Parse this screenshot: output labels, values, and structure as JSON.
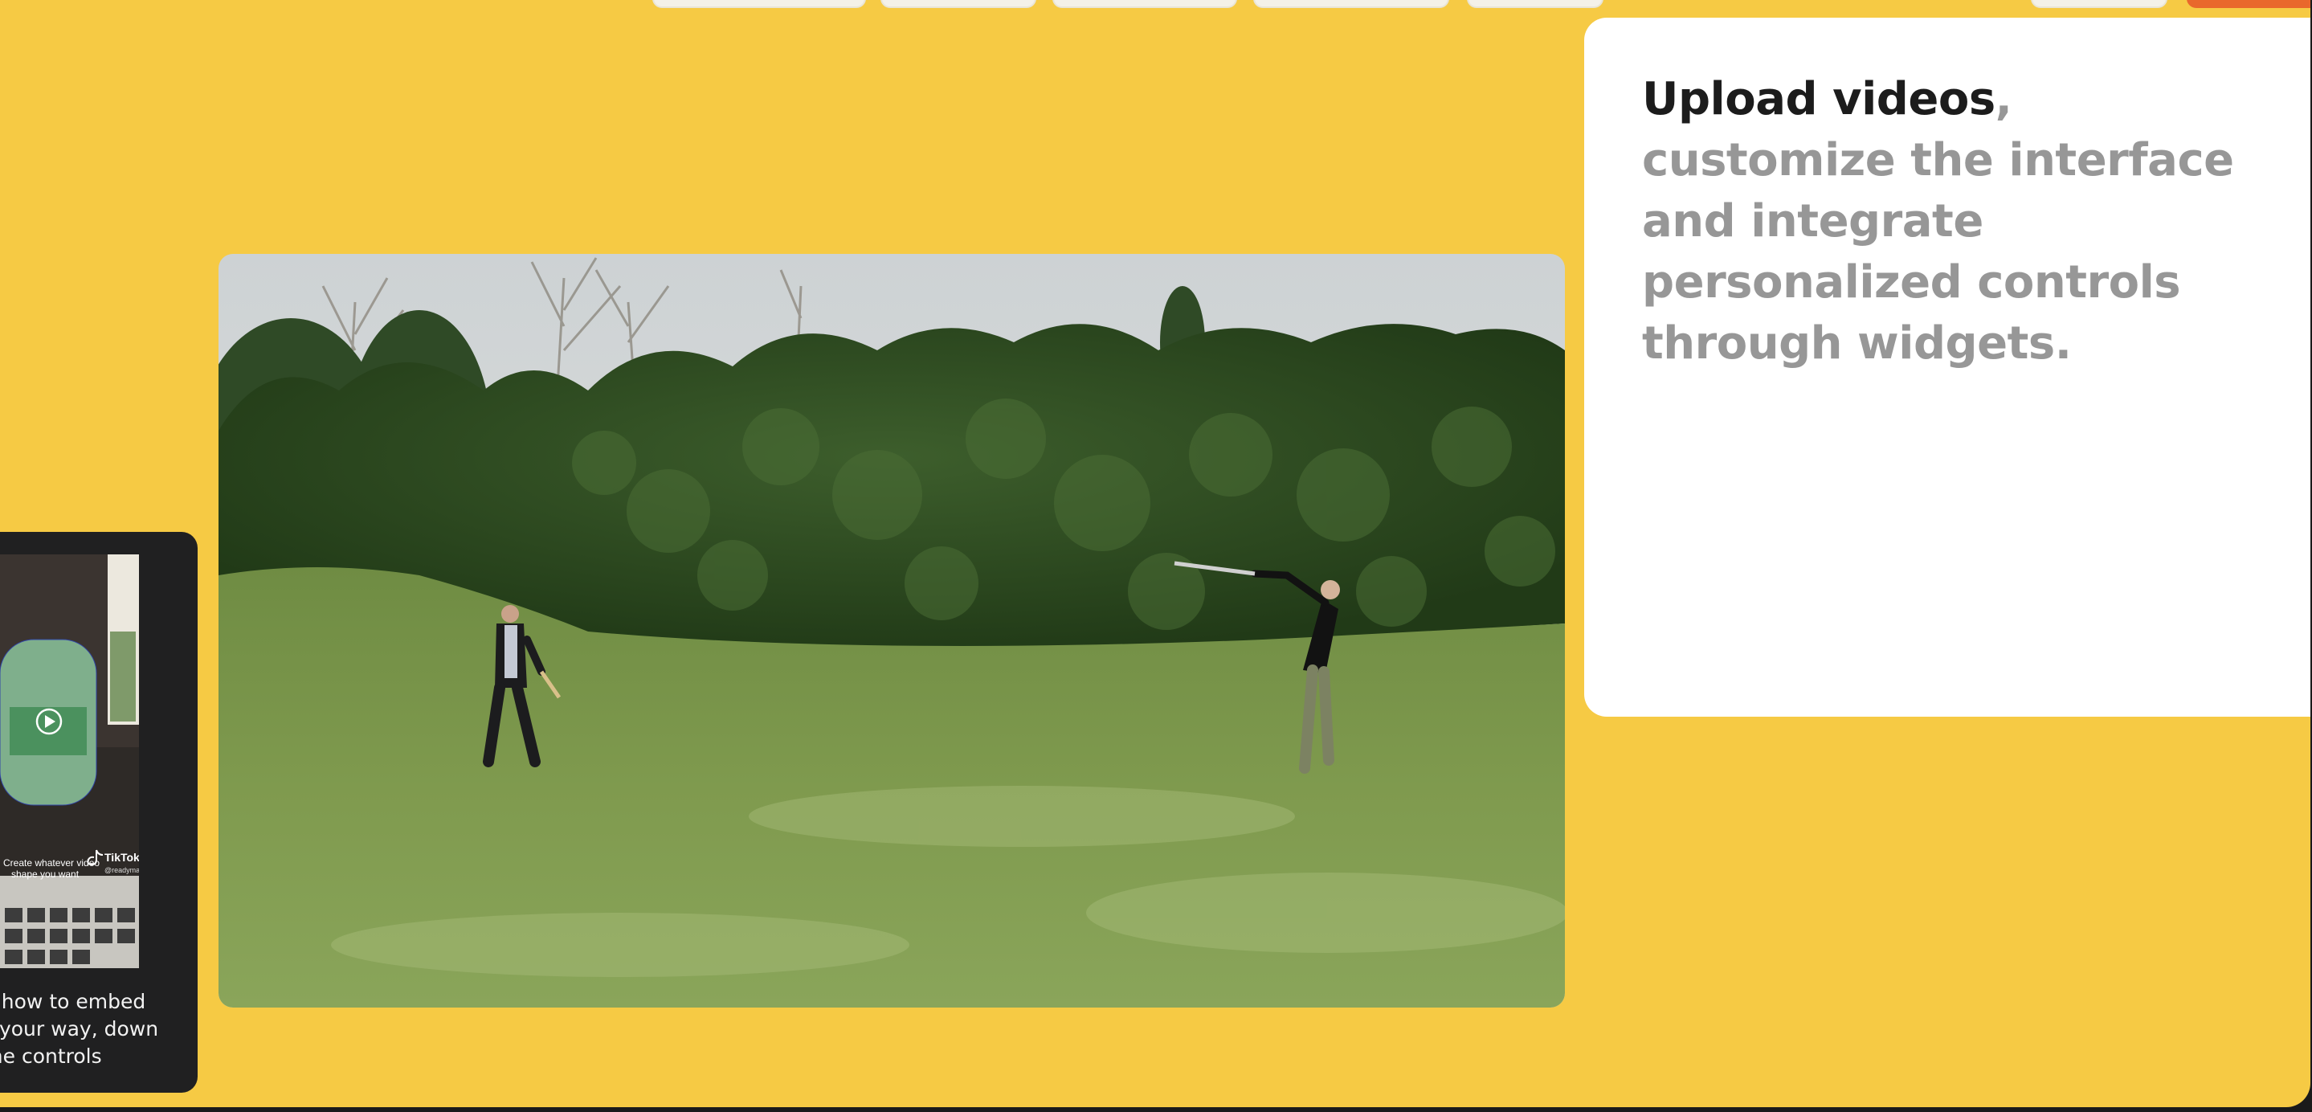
{
  "headline": {
    "strong": "Upload videos",
    "rest": ", customize the interface and integrate personalized controls through widgets."
  },
  "side_card": {
    "thumbnail": {
      "overlay_text_1": "Create whatever video",
      "overlay_text_2": "shape you want",
      "brand": "TikTok",
      "handle": "@readymag"
    },
    "caption_lines": [
      "n how to embed",
      "s your way, down",
      "the controls"
    ]
  },
  "video": {
    "scene": "Two people playing badminton on a grassy field in front of dense green bushes"
  },
  "colors": {
    "background": "#f6ca44",
    "card": "#ffffff",
    "side_card": "#202021",
    "headline_strong": "#1c1c1c",
    "headline_muted": "#979797",
    "accent": "#e9682c"
  },
  "icons": [
    "play-icon",
    "tiktok-logo-icon"
  ]
}
